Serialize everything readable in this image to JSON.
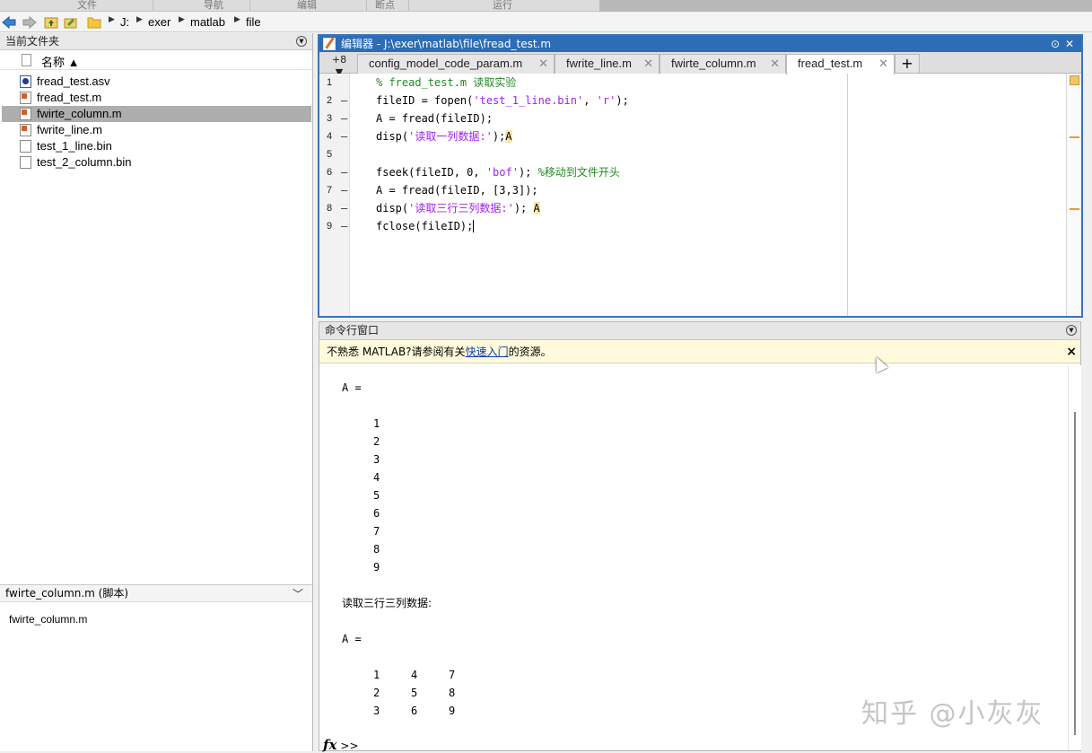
{
  "ribbon": {
    "sections": [
      "文件",
      "导航",
      "编辑",
      "断点",
      "运行"
    ]
  },
  "address_bar": {
    "path": [
      "J:",
      "exer",
      "matlab",
      "file"
    ]
  },
  "current_folder": {
    "title": "当前文件夹",
    "column_header": "名称 ▲",
    "files": [
      {
        "name": "fread_test.asv",
        "type": "asv",
        "selected": false
      },
      {
        "name": "fread_test.m",
        "type": "m",
        "selected": false
      },
      {
        "name": "fwirte_column.m",
        "type": "m",
        "selected": true
      },
      {
        "name": "fwrite_line.m",
        "type": "m",
        "selected": false
      },
      {
        "name": "test_1_line.bin",
        "type": "bin",
        "selected": false
      },
      {
        "name": "test_2_column.bin",
        "type": "bin",
        "selected": false
      }
    ],
    "details_header": "fwirte_column.m  (脚本)",
    "details_body": "fwirte_column.m"
  },
  "editor": {
    "title": "编辑器 - J:\\exer\\matlab\\file\\fread_test.m",
    "more_tabs": "+8",
    "tabs": [
      {
        "label": "config_model_code_param.m",
        "active": false
      },
      {
        "label": "fwrite_line.m",
        "active": false
      },
      {
        "label": "fwirte_column.m",
        "active": false
      },
      {
        "label": "fread_test.m",
        "active": true
      }
    ],
    "add_tab": "+",
    "lines": [
      {
        "n": "1",
        "dash": "",
        "parts": [
          {
            "t": "% fread_test.m 读取实验",
            "c": "comment"
          }
        ]
      },
      {
        "n": "2",
        "dash": "–",
        "parts": [
          {
            "t": "fileID = fopen(",
            "c": ""
          },
          {
            "t": "'test_1_line.bin'",
            "c": "str"
          },
          {
            "t": ", ",
            "c": ""
          },
          {
            "t": "'r'",
            "c": "str"
          },
          {
            "t": ");",
            "c": ""
          }
        ]
      },
      {
        "n": "3",
        "dash": "–",
        "parts": [
          {
            "t": "A = fread(fileID);",
            "c": ""
          }
        ]
      },
      {
        "n": "4",
        "dash": "–",
        "parts": [
          {
            "t": "disp(",
            "c": ""
          },
          {
            "t": "'读取一列数据:'",
            "c": "str"
          },
          {
            "t": ");",
            "c": ""
          },
          {
            "t": "A",
            "c": "hl"
          }
        ]
      },
      {
        "n": "5",
        "dash": "",
        "parts": []
      },
      {
        "n": "6",
        "dash": "–",
        "parts": [
          {
            "t": "fseek(fileID, 0, ",
            "c": ""
          },
          {
            "t": "'bof'",
            "c": "str"
          },
          {
            "t": "); ",
            "c": ""
          },
          {
            "t": "%移动到文件开头",
            "c": "comment"
          }
        ]
      },
      {
        "n": "7",
        "dash": "–",
        "parts": [
          {
            "t": "A = fread(fileID, [3,3]);",
            "c": ""
          }
        ]
      },
      {
        "n": "8",
        "dash": "–",
        "parts": [
          {
            "t": "disp(",
            "c": ""
          },
          {
            "t": "'读取三行三列数据:'",
            "c": "str"
          },
          {
            "t": "); ",
            "c": ""
          },
          {
            "t": "A",
            "c": "hl"
          }
        ]
      },
      {
        "n": "9",
        "dash": "–",
        "parts": [
          {
            "t": "fclose(fileID);",
            "c": ""
          }
        ]
      }
    ]
  },
  "command_window": {
    "title": "命令行窗口",
    "notice_before": "不熟悉 MATLAB?请参阅有关",
    "notice_link": "快速入门",
    "notice_after": "的资源。",
    "notice_close": "×",
    "output": {
      "a1_label": "A =",
      "column": [
        "1",
        "2",
        "3",
        "4",
        "5",
        "6",
        "7",
        "8",
        "9"
      ],
      "heading2": "读取三行三列数据:",
      "a2_label": "A =",
      "matrix": [
        [
          "1",
          "4",
          "7"
        ],
        [
          "2",
          "5",
          "8"
        ],
        [
          "3",
          "6",
          "9"
        ]
      ]
    },
    "prompt_fx": "fx",
    "prompt": ">>"
  },
  "watermark": "知乎 @小灰灰"
}
